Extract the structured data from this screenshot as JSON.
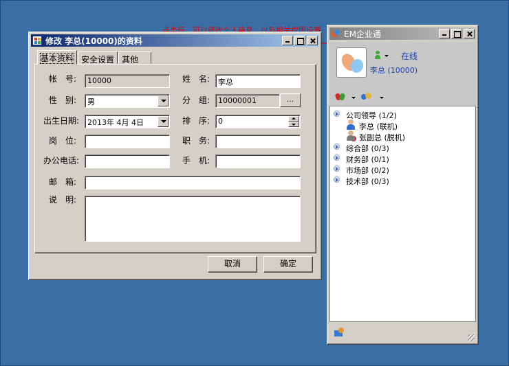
{
  "annotation": "点击后，可以修改个人信息，以及相关权限设置",
  "dialog": {
    "title": "修改 李总(10000)的资料",
    "tabs": [
      "基本资料",
      "安全设置",
      "其他"
    ],
    "labels": {
      "account": "帐　号:",
      "name": "姓　名:",
      "gender": "性　别:",
      "group": "分　组:",
      "birthday": "出生日期:",
      "order": "排　序:",
      "position": "岗　位:",
      "duty": "职　务:",
      "office_phone": "办公电话:",
      "mobile": "手　机:",
      "email": "邮　箱:",
      "remark": "说　明:"
    },
    "values": {
      "account": "10000",
      "name": "李总",
      "gender": "男",
      "group": "10000001",
      "birthday": "2013年 4月 4日",
      "order": "0",
      "position": "",
      "duty": "",
      "office_phone": "",
      "mobile": "",
      "email": "",
      "remark": ""
    },
    "browse_label": "...",
    "cancel_label": "取消",
    "ok_label": "确定"
  },
  "em": {
    "title": "EM企业通",
    "status": "在线",
    "user": "李总 (10000)",
    "groups": [
      {
        "label": "公司领导 (1/2)"
      },
      {
        "label": "综合部 (0/3)"
      },
      {
        "label": "财务部 (0/1)"
      },
      {
        "label": "市场部 (0/2)"
      },
      {
        "label": "技术部 (0/3)"
      }
    ],
    "members": [
      {
        "label": "李总 (联机)",
        "status": "online"
      },
      {
        "label": "张副总 (脱机)",
        "status": "offline"
      }
    ]
  },
  "colors": {
    "desktop": "#3a6ea5",
    "active_title": "#0a246a",
    "annotation": "#e00000",
    "link": "#1a3fb0"
  }
}
